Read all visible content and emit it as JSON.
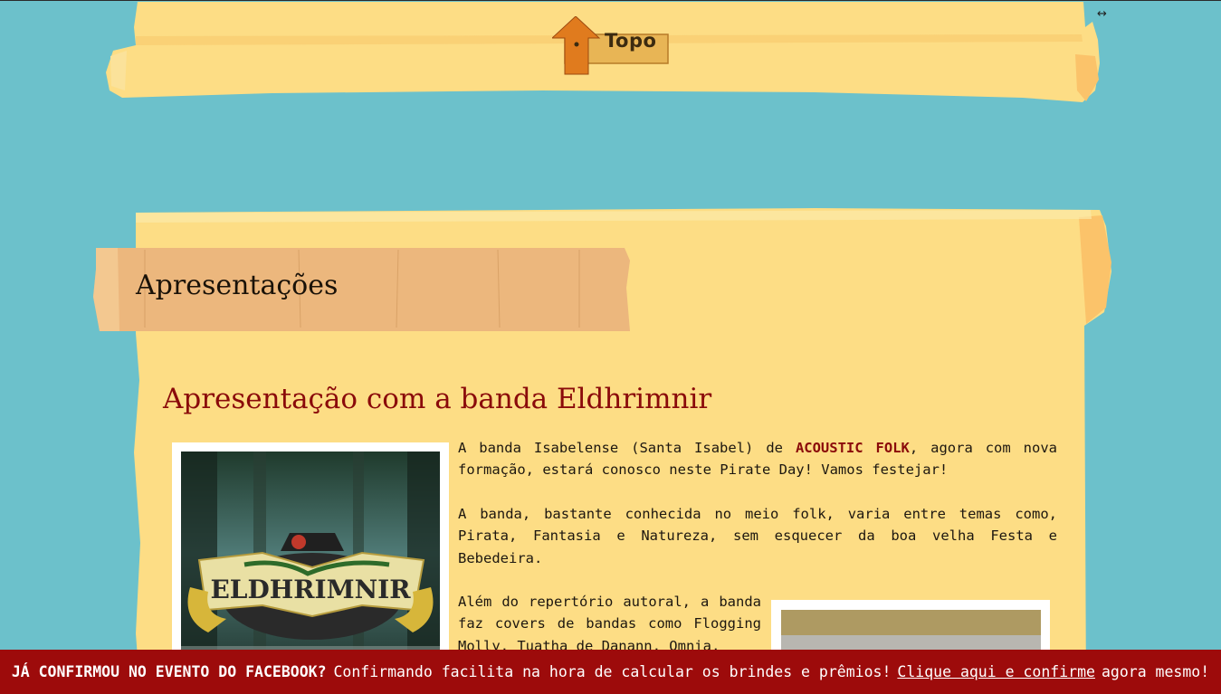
{
  "header": {
    "topo_label": "Topo",
    "expand_icon": "↔"
  },
  "section": {
    "title": "Apresentações"
  },
  "post": {
    "title": "Apresentação com a banda Eldhrimnir",
    "poster_text": "ELDHRIMNIR",
    "paragraphs": {
      "p1_before": "A banda Isabelense (Santa Isabel) de ",
      "p1_highlight": "ACOUSTIC FOLK",
      "p1_after": ", agora com nova formação, estará conosco neste Pirate Day! Vamos festejar!",
      "p2": "A banda, bastante conhecida no meio folk, varia entre temas como, Pirata, Fantasia e Natureza, sem esquecer da boa velha Festa e Bebedeira.",
      "p3": "Além do repertório autoral, a banda faz covers de bandas como Flogging Molly, Tuatha de Danann, Omnia,"
    }
  },
  "notice": {
    "strong": "JÁ CONFIRMOU NO EVENTO DO FACEBOOK?",
    "text_before": "Confirmando facilita na hora de calcular os brindes e prêmios!",
    "link": "Clique aqui e confirme",
    "text_after": "agora mesmo!"
  },
  "colors": {
    "sky": "#6cc1cb",
    "parchment": "#fddd85",
    "ribbon": "#ecb77d",
    "title_red": "#8a0a0a",
    "notice_bg": "#9d0b0b"
  }
}
